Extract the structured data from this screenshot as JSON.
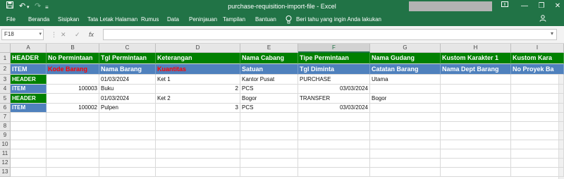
{
  "titlebar": {
    "title": "purchase-requisition-import-file  -  Excel",
    "save_icon": "save-icon",
    "undo_icon": "undo-icon",
    "redo_icon": "redo-icon",
    "customize_icon": "customize-qat-icon"
  },
  "ribbon": {
    "tabs": [
      "File",
      "Beranda",
      "Sisipkan",
      "Tata Letak Halaman",
      "Rumus",
      "Data",
      "Peninjauan",
      "Tampilan",
      "Bantuan"
    ],
    "tell_me": "Beri tahu yang ingin Anda lakukan",
    "brand_color": "#217346"
  },
  "formula_bar": {
    "name_box": "F18",
    "cancel": "✕",
    "enter": "✓",
    "fx": "fx",
    "content": ""
  },
  "columns": [
    "A",
    "B",
    "C",
    "D",
    "E",
    "F",
    "G",
    "H",
    "I"
  ],
  "selected_column": "F",
  "rows": [
    {
      "num": "1",
      "cells": [
        {
          "text": "HEADER",
          "bg": "#008000",
          "color": "#ffffff",
          "bold": true
        },
        {
          "text": "No Permintaan",
          "bg": "#008000",
          "color": "#ffffff",
          "bold": true
        },
        {
          "text": "Tgl Permintaan",
          "bg": "#008000",
          "color": "#ffffff",
          "bold": true
        },
        {
          "text": "Keterangan",
          "bg": "#008000",
          "color": "#ffffff",
          "bold": true
        },
        {
          "text": "Nama Cabang",
          "bg": "#008000",
          "color": "#ffffff",
          "bold": true
        },
        {
          "text": "Tipe Permintaan",
          "bg": "#008000",
          "color": "#ffffff",
          "bold": true
        },
        {
          "text": "Nama Gudang",
          "bg": "#008000",
          "color": "#ffffff",
          "bold": true
        },
        {
          "text": "Kustom Karakter 1",
          "bg": "#008000",
          "color": "#ffffff",
          "bold": true
        },
        {
          "text": "Kustom Kara",
          "bg": "#008000",
          "color": "#ffffff",
          "bold": true
        }
      ]
    },
    {
      "num": "2",
      "cells": [
        {
          "text": "ITEM",
          "bg": "#4f81bd",
          "color": "#ffffff",
          "bold": true
        },
        {
          "text": "Kode Barang",
          "bg": "#4f81bd",
          "color": "#ff0000",
          "bold": true
        },
        {
          "text": "Nama Barang",
          "bg": "#4f81bd",
          "color": "#ffffff",
          "bold": true
        },
        {
          "text": "Kuantitas",
          "bg": "#4f81bd",
          "color": "#ff0000",
          "bold": true
        },
        {
          "text": "Satuan",
          "bg": "#4f81bd",
          "color": "#ffffff",
          "bold": true
        },
        {
          "text": "Tgl Diminta",
          "bg": "#4f81bd",
          "color": "#ffffff",
          "bold": true
        },
        {
          "text": "Catatan Barang",
          "bg": "#4f81bd",
          "color": "#ffffff",
          "bold": true
        },
        {
          "text": "Nama Dept Barang",
          "bg": "#4f81bd",
          "color": "#ffffff",
          "bold": true
        },
        {
          "text": "No Proyek Ba",
          "bg": "#4f81bd",
          "color": "#ffffff",
          "bold": true
        }
      ]
    },
    {
      "num": "3",
      "cells": [
        {
          "text": "HEADER",
          "bg": "#008000",
          "color": "#ffffff",
          "bold": true
        },
        {
          "text": ""
        },
        {
          "text": "01/03/2024"
        },
        {
          "text": "Ket 1"
        },
        {
          "text": "Kantor Pusat"
        },
        {
          "text": "PURCHASE"
        },
        {
          "text": "Utama"
        },
        {
          "text": ""
        },
        {
          "text": ""
        }
      ]
    },
    {
      "num": "4",
      "cells": [
        {
          "text": "ITEM",
          "bg": "#4f81bd",
          "color": "#ffffff",
          "bold": true
        },
        {
          "text": "100003",
          "align": "right"
        },
        {
          "text": "Buku"
        },
        {
          "text": "2",
          "align": "right"
        },
        {
          "text": "PCS"
        },
        {
          "text": "03/03/2024",
          "align": "right"
        },
        {
          "text": ""
        },
        {
          "text": ""
        },
        {
          "text": ""
        }
      ]
    },
    {
      "num": "5",
      "cells": [
        {
          "text": "HEADER",
          "bg": "#008000",
          "color": "#ffffff",
          "bold": true
        },
        {
          "text": ""
        },
        {
          "text": "01/03/2024"
        },
        {
          "text": "Ket 2"
        },
        {
          "text": "Bogor"
        },
        {
          "text": "TRANSFER"
        },
        {
          "text": "Bogor"
        },
        {
          "text": ""
        },
        {
          "text": ""
        }
      ]
    },
    {
      "num": "6",
      "cells": [
        {
          "text": "ITEM",
          "bg": "#4f81bd",
          "color": "#ffffff",
          "bold": true
        },
        {
          "text": "100002",
          "align": "right"
        },
        {
          "text": "Pulpen"
        },
        {
          "text": "3",
          "align": "right"
        },
        {
          "text": "PCS"
        },
        {
          "text": "03/03/2024",
          "align": "right"
        },
        {
          "text": ""
        },
        {
          "text": ""
        },
        {
          "text": ""
        }
      ]
    },
    {
      "num": "7",
      "cells": []
    },
    {
      "num": "8",
      "cells": []
    },
    {
      "num": "9",
      "cells": []
    },
    {
      "num": "10",
      "cells": []
    },
    {
      "num": "11",
      "cells": []
    },
    {
      "num": "12",
      "cells": []
    },
    {
      "num": "13",
      "cells": []
    }
  ]
}
